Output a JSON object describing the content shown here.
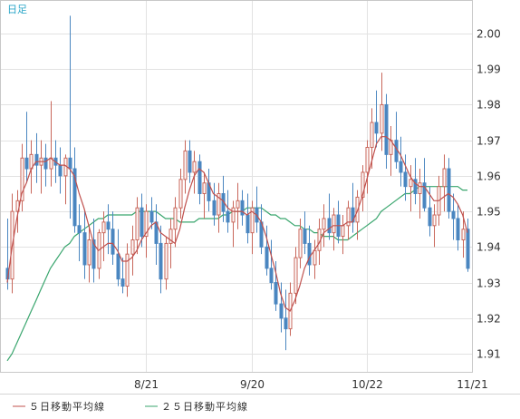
{
  "period_label": "日足",
  "colors": {
    "up_body": "#ffffff",
    "up_border": "#c8665a",
    "down_body": "#4a86c0",
    "down_border": "#4a86c0",
    "wick_up": "#c8665a",
    "wick_down": "#4a86c0",
    "ma5": "#c0504d",
    "ma25": "#3aa66e",
    "grid": "#e2e2e2",
    "frame": "#c8c8c8"
  },
  "chart_data": {
    "type": "candlestick",
    "title": "",
    "xlabel": "",
    "ylabel": "",
    "ylim": [
      1.9,
      2.01
    ],
    "y_ticks": [
      "2.00",
      "1.99",
      "1.98",
      "1.97",
      "1.96",
      "1.95",
      "1.94",
      "1.93",
      "1.92",
      "1.91"
    ],
    "x_ticks": [
      {
        "label": "8/21",
        "index": 29
      },
      {
        "label": "9/20",
        "index": 51
      },
      {
        "label": "10/22",
        "index": 75
      },
      {
        "label": "11/21",
        "index": 97
      }
    ],
    "grid": true,
    "legend_position": "bottom-left",
    "legend": [
      "５日移動平均線",
      "２５日移動平均線"
    ],
    "candles": [
      [
        1.934,
        1.948,
        1.928,
        1.931
      ],
      [
        1.931,
        1.955,
        1.927,
        1.95
      ],
      [
        1.95,
        1.956,
        1.944,
        1.953
      ],
      [
        1.953,
        1.969,
        1.95,
        1.965
      ],
      [
        1.965,
        1.978,
        1.958,
        1.962
      ],
      [
        1.962,
        1.97,
        1.955,
        1.966
      ],
      [
        1.966,
        1.972,
        1.958,
        1.963
      ],
      [
        1.963,
        1.97,
        1.955,
        1.965
      ],
      [
        1.965,
        1.969,
        1.957,
        1.962
      ],
      [
        1.962,
        1.981,
        1.957,
        1.965
      ],
      [
        1.965,
        1.97,
        1.958,
        1.963
      ],
      [
        1.963,
        1.968,
        1.955,
        1.96
      ],
      [
        1.96,
        1.966,
        1.952,
        1.965
      ],
      [
        1.965,
        2.005,
        1.948,
        1.962
      ],
      [
        1.962,
        1.968,
        1.944,
        1.946
      ],
      [
        1.946,
        1.952,
        1.936,
        1.944
      ],
      [
        1.944,
        1.95,
        1.931,
        1.935
      ],
      [
        1.935,
        1.946,
        1.93,
        1.942
      ],
      [
        1.942,
        1.948,
        1.93,
        1.934
      ],
      [
        1.934,
        1.945,
        1.931,
        1.944
      ],
      [
        1.944,
        1.95,
        1.936,
        1.947
      ],
      [
        1.947,
        1.952,
        1.938,
        1.945
      ],
      [
        1.945,
        1.95,
        1.935,
        1.938
      ],
      [
        1.938,
        1.945,
        1.929,
        1.931
      ],
      [
        1.931,
        1.937,
        1.927,
        1.929
      ],
      [
        1.929,
        1.941,
        1.926,
        1.938
      ],
      [
        1.938,
        1.946,
        1.932,
        1.942
      ],
      [
        1.942,
        1.954,
        1.938,
        1.951
      ],
      [
        1.951,
        1.955,
        1.94,
        1.943
      ],
      [
        1.943,
        1.952,
        1.937,
        1.95
      ],
      [
        1.95,
        1.954,
        1.945,
        1.947
      ],
      [
        1.947,
        1.952,
        1.935,
        1.941
      ],
      [
        1.941,
        1.946,
        1.927,
        1.931
      ],
      [
        1.931,
        1.943,
        1.928,
        1.941
      ],
      [
        1.941,
        1.948,
        1.934,
        1.945
      ],
      [
        1.945,
        1.954,
        1.94,
        1.951
      ],
      [
        1.951,
        1.962,
        1.948,
        1.959
      ],
      [
        1.959,
        1.97,
        1.955,
        1.967
      ],
      [
        1.967,
        1.97,
        1.958,
        1.961
      ],
      [
        1.961,
        1.967,
        1.955,
        1.964
      ],
      [
        1.964,
        1.966,
        1.952,
        1.955
      ],
      [
        1.955,
        1.961,
        1.948,
        1.958
      ],
      [
        1.958,
        1.962,
        1.95,
        1.953
      ],
      [
        1.953,
        1.958,
        1.946,
        1.949
      ],
      [
        1.949,
        1.958,
        1.944,
        1.955
      ],
      [
        1.955,
        1.96,
        1.947,
        1.95
      ],
      [
        1.95,
        1.956,
        1.944,
        1.947
      ],
      [
        1.947,
        1.953,
        1.94,
        1.951
      ],
      [
        1.951,
        1.958,
        1.945,
        1.953
      ],
      [
        1.953,
        1.956,
        1.946,
        1.949
      ],
      [
        1.949,
        1.955,
        1.941,
        1.944
      ],
      [
        1.944,
        1.953,
        1.938,
        1.951
      ],
      [
        1.951,
        1.957,
        1.944,
        1.947
      ],
      [
        1.947,
        1.952,
        1.938,
        1.94
      ],
      [
        1.94,
        1.946,
        1.932,
        1.934
      ],
      [
        1.934,
        1.942,
        1.928,
        1.93
      ],
      [
        1.93,
        1.936,
        1.922,
        1.924
      ],
      [
        1.924,
        1.93,
        1.916,
        1.92
      ],
      [
        1.92,
        1.928,
        1.911,
        1.917
      ],
      [
        1.917,
        1.93,
        1.915,
        1.927
      ],
      [
        1.927,
        1.94,
        1.924,
        1.937
      ],
      [
        1.937,
        1.948,
        1.934,
        1.945
      ],
      [
        1.945,
        1.95,
        1.938,
        1.941
      ],
      [
        1.941,
        1.946,
        1.932,
        1.935
      ],
      [
        1.935,
        1.942,
        1.931,
        1.939
      ],
      [
        1.939,
        1.948,
        1.935,
        1.945
      ],
      [
        1.945,
        1.952,
        1.94,
        1.948
      ],
      [
        1.948,
        1.955,
        1.942,
        1.944
      ],
      [
        1.944,
        1.951,
        1.939,
        1.949
      ],
      [
        1.949,
        1.953,
        1.941,
        1.943
      ],
      [
        1.943,
        1.949,
        1.938,
        1.946
      ],
      [
        1.946,
        1.953,
        1.942,
        1.951
      ],
      [
        1.951,
        1.958,
        1.944,
        1.947
      ],
      [
        1.947,
        1.956,
        1.942,
        1.954
      ],
      [
        1.954,
        1.963,
        1.95,
        1.961
      ],
      [
        1.961,
        1.97,
        1.955,
        1.968
      ],
      [
        1.968,
        1.979,
        1.962,
        1.975
      ],
      [
        1.975,
        1.984,
        1.968,
        1.972
      ],
      [
        1.972,
        1.989,
        1.967,
        1.98
      ],
      [
        1.98,
        1.983,
        1.962,
        1.966
      ],
      [
        1.966,
        1.974,
        1.96,
        1.97
      ],
      [
        1.97,
        1.978,
        1.962,
        1.964
      ],
      [
        1.964,
        1.971,
        1.957,
        1.961
      ],
      [
        1.961,
        1.966,
        1.953,
        1.957
      ],
      [
        1.957,
        1.963,
        1.95,
        1.959
      ],
      [
        1.959,
        1.965,
        1.952,
        1.955
      ],
      [
        1.955,
        1.962,
        1.948,
        1.958
      ],
      [
        1.958,
        1.965,
        1.95,
        1.951
      ],
      [
        1.951,
        1.957,
        1.943,
        1.946
      ],
      [
        1.946,
        1.952,
        1.94,
        1.949
      ],
      [
        1.949,
        1.96,
        1.946,
        1.957
      ],
      [
        1.957,
        1.966,
        1.95,
        1.962
      ],
      [
        1.962,
        1.965,
        1.948,
        1.95
      ],
      [
        1.95,
        1.955,
        1.942,
        1.948
      ],
      [
        1.948,
        1.952,
        1.939,
        1.942
      ],
      [
        1.942,
        1.95,
        1.937,
        1.945
      ],
      [
        1.945,
        1.948,
        1.933,
        1.934
      ]
    ],
    "series": [
      {
        "name": "５日移動平均線",
        "values": [
          1.93,
          1.94,
          1.948,
          1.955,
          1.958,
          1.962,
          1.964,
          1.964,
          1.964,
          1.965,
          1.964,
          1.963,
          1.963,
          1.962,
          1.96,
          1.955,
          1.951,
          1.946,
          1.941,
          1.939,
          1.94,
          1.941,
          1.941,
          1.939,
          1.936,
          1.936,
          1.937,
          1.939,
          1.942,
          1.944,
          1.946,
          1.947,
          1.944,
          1.943,
          1.942,
          1.941,
          1.945,
          1.951,
          1.956,
          1.96,
          1.962,
          1.961,
          1.958,
          1.955,
          1.954,
          1.953,
          1.951,
          1.95,
          1.95,
          1.95,
          1.949,
          1.95,
          1.949,
          1.947,
          1.943,
          1.938,
          1.933,
          1.927,
          1.923,
          1.922,
          1.925,
          1.929,
          1.934,
          1.937,
          1.939,
          1.941,
          1.944,
          1.945,
          1.946,
          1.946,
          1.946,
          1.947,
          1.947,
          1.95,
          1.954,
          1.959,
          1.964,
          1.969,
          1.971,
          1.971,
          1.97,
          1.968,
          1.966,
          1.963,
          1.96,
          1.958,
          1.957,
          1.957,
          1.955,
          1.953,
          1.953,
          1.954,
          1.955,
          1.954,
          1.952,
          1.949,
          1.944
        ]
      },
      {
        "name": "２５日移動平均線",
        "values": [
          1.908,
          1.91,
          1.913,
          1.916,
          1.919,
          1.922,
          1.925,
          1.928,
          1.931,
          1.934,
          1.936,
          1.938,
          1.94,
          1.941,
          1.943,
          1.944,
          1.945,
          1.946,
          1.947,
          1.948,
          1.948,
          1.949,
          1.949,
          1.949,
          1.949,
          1.949,
          1.949,
          1.95,
          1.95,
          1.95,
          1.95,
          1.95,
          1.949,
          1.948,
          1.948,
          1.948,
          1.947,
          1.947,
          1.947,
          1.947,
          1.948,
          1.948,
          1.948,
          1.948,
          1.948,
          1.949,
          1.949,
          1.95,
          1.95,
          1.95,
          1.951,
          1.951,
          1.951,
          1.951,
          1.95,
          1.949,
          1.949,
          1.948,
          1.948,
          1.947,
          1.946,
          1.946,
          1.945,
          1.945,
          1.944,
          1.944,
          1.943,
          1.943,
          1.943,
          1.942,
          1.942,
          1.942,
          1.943,
          1.944,
          1.945,
          1.946,
          1.947,
          1.948,
          1.95,
          1.951,
          1.952,
          1.953,
          1.954,
          1.955,
          1.955,
          1.956,
          1.957,
          1.957,
          1.957,
          1.957,
          1.957,
          1.957,
          1.957,
          1.957,
          1.957,
          1.956,
          1.956
        ]
      }
    ]
  }
}
